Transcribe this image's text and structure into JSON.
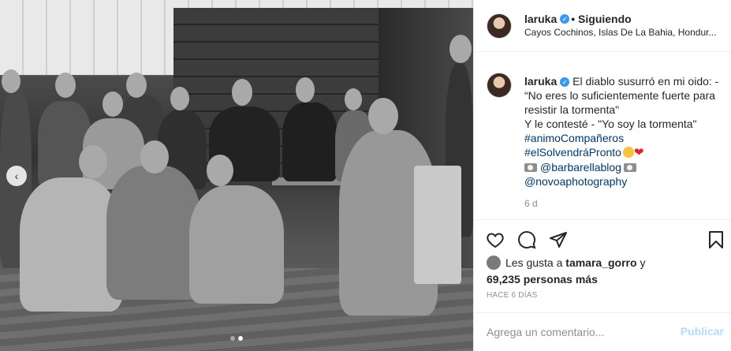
{
  "post": {
    "username": "laruka",
    "follow_status": "• Siguiendo",
    "location": "Cayos Cochinos, Islas De La Bahia, Hondur...",
    "caption": {
      "username": "laruka",
      "line1": "El diablo susurró en mi oido: -",
      "line2": "“No eres lo suficientemente fuerte para",
      "line3": "resistir la tormenta\"",
      "line4": "Y le contesté - \"Yo soy la tormenta\"",
      "hashtag1": "#animoCompañeros",
      "hashtag2": "#elSolvendráPronto",
      "mention1": "@barbarellablog",
      "mention2": "@novoaphotography"
    },
    "caption_age": "6 d",
    "likes_prefix": "Les gusta a",
    "likes_user": "tamara_gorro",
    "likes_and": "y",
    "likes_count": "69,235 personas más",
    "timestamp": "HACE 6 DÍAS",
    "comment_placeholder": "Agrega un comentario...",
    "post_button": "Publicar"
  },
  "icons": {
    "verified": "verified-badge-icon",
    "like": "heart-icon",
    "comment": "comment-icon",
    "share": "share-icon",
    "save": "bookmark-icon",
    "prev": "chevron-left-icon"
  },
  "colors": {
    "verified": "#3897f0",
    "link": "#00376b",
    "muted": "#8e8e8e",
    "post_button": "#b3dbff"
  }
}
